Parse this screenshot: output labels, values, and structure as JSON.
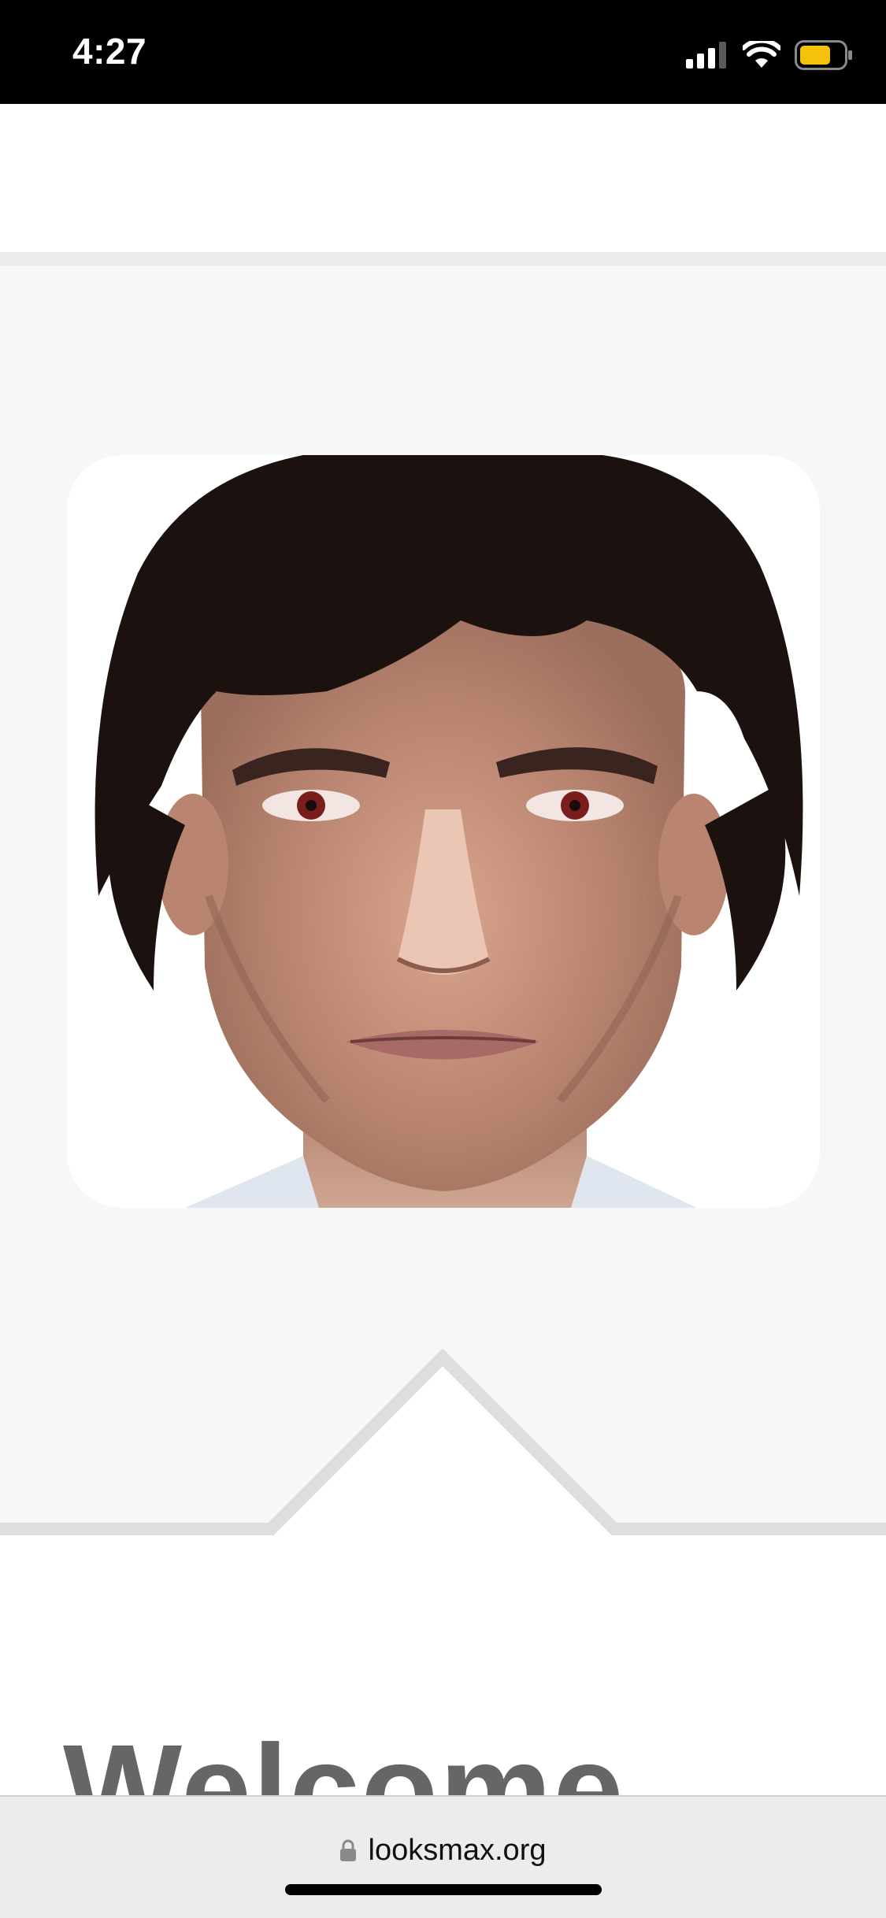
{
  "status_bar": {
    "time": "4:27",
    "icons": [
      "cellular-signal-icon",
      "wifi-icon",
      "battery-icon"
    ],
    "battery_color": "#f4c20d"
  },
  "hero": {
    "avatar_description_icon": "profile-photo"
  },
  "content": {
    "heading_partial": "Welcome"
  },
  "browser": {
    "url": "looksmax.org",
    "lock_icon": "lock-icon"
  },
  "colors": {
    "hero_background": "#f7f7f7",
    "separator": "#dedede",
    "status_bar_bg": "#000000"
  }
}
